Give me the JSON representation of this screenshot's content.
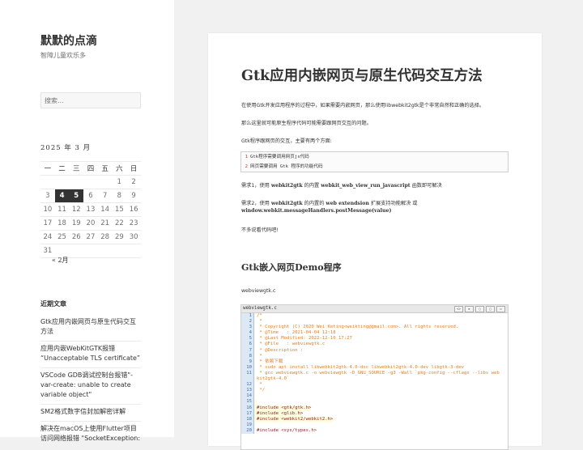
{
  "site": {
    "title": "默默的点滴",
    "description": "智障儿童欢乐多"
  },
  "search": {
    "placeholder": "搜索..."
  },
  "calendar": {
    "caption": "2025 年 3 月",
    "weekdays": [
      "一",
      "二",
      "三",
      "四",
      "五",
      "六",
      "日"
    ],
    "weeks": [
      [
        "",
        "",
        "",
        "",
        "",
        "1",
        "2"
      ],
      [
        "3",
        "4",
        "5",
        "6",
        "7",
        "8",
        "9"
      ],
      [
        "10",
        "11",
        "12",
        "13",
        "14",
        "15",
        "16"
      ],
      [
        "17",
        "18",
        "19",
        "20",
        "21",
        "22",
        "23"
      ],
      [
        "24",
        "25",
        "26",
        "27",
        "28",
        "29",
        "30"
      ],
      [
        "31",
        "",
        "",
        "",
        "",
        "",
        ""
      ]
    ],
    "prev": "« 2月"
  },
  "recent": {
    "title": "近期文章",
    "items": [
      "Gtk应用内嵌网页与原生代码交互方法",
      "应用内嵌WebKitGTK报错 “Unacceptable TLS certificate”",
      "VSCode GDB调试控制台报错\"-var-create: unable to create variable object\"",
      "SM2格式数字信封加解密详解",
      "解决在macOS上使用Flutter项目访问网络报错 \"SocketException:"
    ]
  },
  "article": {
    "title": "Gtk应用内嵌网页与原生代码交互方法",
    "p1": "在使用Gtk开发应用程序的过程中，如果需要内嵌网页，那么使用libwebkit2gtk是个非常自然和正确的选择。",
    "p2": "那么这里就可能原生程序代码可能需要跟网页交互的问题。",
    "p3": "Gtk程序跟网页的交互，主要有两个方面:",
    "list": [
      {
        "num": "1",
        "text": "Gtk程序需要调用网页js代码"
      },
      {
        "num": "2",
        "text": "网页需要调用 Gtk 程序的功能代码"
      }
    ],
    "need1_pre": "需求1，使用 ",
    "need1_b1": "webkit2gtk",
    "need1_mid": " 的内置 ",
    "need1_b2": "webkit_web_view_run_javascript",
    "need1_post": " 函数即可解决",
    "need2_pre": "需求2，使用 ",
    "need2_b1": "webkit2gtk",
    "need2_mid": " 的内置的 ",
    "need2_b2": "web extendsion",
    "need2_post": " 扩展支持功能解决 或",
    "need2_b3": "window.webkit.messageHandlers.postMessage(value)",
    "p_end": "不多说看代码吧!",
    "h2": "Gtk嵌入网页Demo程序",
    "file": "webviewgtk.c",
    "code": {
      "filename": "webviewgtk.c",
      "tools": [
        "<>",
        "≡",
        "▢",
        "□",
        "▭"
      ],
      "lines": [
        {
          "n": "1",
          "t": "/*",
          "k": "cm"
        },
        {
          "n": "2",
          "t": " *",
          "k": "cm"
        },
        {
          "n": "3",
          "t": " * Copyright (C) 2020 Wei Keting<weikting@gmail.com>. All rights reserved.",
          "k": "cm"
        },
        {
          "n": "4",
          "t": " * @Time   : 2021-04-04 12:18",
          "k": "cm"
        },
        {
          "n": "5",
          "t": " * @Last Modified: 2022-12-10 17:27",
          "k": "cm"
        },
        {
          "n": "6",
          "t": " * @File   : webviewgtk.c",
          "k": "cm"
        },
        {
          "n": "7",
          "t": " * @Description :",
          "k": "cm"
        },
        {
          "n": "8",
          "t": " *",
          "k": "cm"
        },
        {
          "n": "9",
          "t": " * 依赖下载",
          "k": "cm"
        },
        {
          "n": "10",
          "t": " * sudo apt install libwebkit2gtk-4.0-doc libwebkit2gtk-4.0-dev libgtk-3-dev",
          "k": "cm"
        },
        {
          "n": "11",
          "t": " * gcc webviewgtk.c -o webviewgtk -D_GNU_SOURCE -g3 -Wall `pkg-config --cflags --libs web",
          "k": "cm"
        },
        {
          "n": "",
          "t": "kit2gtk-4.0`",
          "k": "cm"
        },
        {
          "n": "12",
          "t": " *",
          "k": "cm"
        },
        {
          "n": "13",
          "t": " */",
          "k": "cm"
        },
        {
          "n": "14",
          "t": "",
          "k": "pp"
        },
        {
          "n": "15",
          "t": "",
          "k": "pp"
        },
        {
          "n": "16",
          "t": "#include <gtk/gtk.h>",
          "k": "pp"
        },
        {
          "n": "17",
          "t": "#include <glib.h>",
          "k": "pp"
        },
        {
          "n": "18",
          "t": "#include <webkit2/webkit2.h>",
          "k": "pp"
        },
        {
          "n": "19",
          "t": "",
          "k": "pp"
        },
        {
          "n": "20",
          "t": "#include <sys/types.h>",
          "k": "pp"
        }
      ]
    }
  }
}
